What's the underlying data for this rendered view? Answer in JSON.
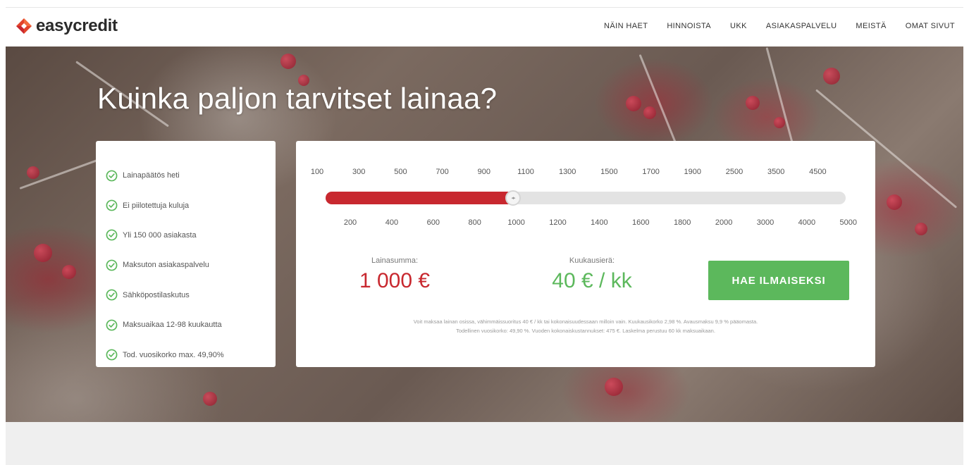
{
  "brand": {
    "name": "easycredit",
    "logo_color": "#e2432a",
    "logo_color_2": "#c8282f"
  },
  "nav": {
    "items": [
      {
        "label": "NÄIN HAET"
      },
      {
        "label": "HINNOISTA"
      },
      {
        "label": "UKK"
      },
      {
        "label": "ASIAKASPALVELU"
      },
      {
        "label": "MEISTÄ"
      },
      {
        "label": "OMAT SIVUT"
      }
    ]
  },
  "hero": {
    "title": "Kuinka paljon tarvitset lainaa?"
  },
  "features": [
    {
      "text": "Lainapäätös heti",
      "icon": "check-circle-icon"
    },
    {
      "text": "Ei piilotettuja kuluja",
      "icon": "check-circle-icon"
    },
    {
      "text": "Yli 150 000 asiakasta",
      "icon": "check-circle-icon"
    },
    {
      "text": "Maksuton asiakaspalvelu",
      "icon": "check-circle-icon"
    },
    {
      "text": "Sähköpostilaskutus",
      "icon": "check-circle-icon"
    },
    {
      "text": "Maksuaikaa 12-98 kuukautta",
      "icon": "check-circle-icon"
    },
    {
      "text": "Tod. vuosikorko max. 49,90%",
      "icon": "check-circle-icon"
    }
  ],
  "calculator": {
    "top_ticks": [
      "100",
      "300",
      "500",
      "700",
      "900",
      "1100",
      "1300",
      "1500",
      "1700",
      "1900",
      "2500",
      "3500",
      "4500"
    ],
    "bottom_ticks": [
      "200",
      "400",
      "600",
      "800",
      "1000",
      "1200",
      "1400",
      "1600",
      "1800",
      "2000",
      "3000",
      "4000",
      "5000"
    ],
    "slider_fraction": 0.36,
    "amount_label": "Lainasumma:",
    "amount_value": "1 000 €",
    "monthly_label": "Kuukausierä:",
    "monthly_value": "40 € / kk",
    "cta_label": "HAE ILMAISEKSI",
    "disclaimer_line1": "Voit maksaa lainan osissa, vähimmäissuoritus 40 € / kk tai kokonaisuudessaan milloin vain. Kuukausikorko 2,98 %. Avausmaksu 9,9 % pääomasta.",
    "disclaimer_line2": "Todellinen vuosikorko: 49,90 %. Vuoden kokonaiskustannukset: 475 €. Laskelma perustuu 60 kk maksuaikaan.",
    "accent_red": "#c8282f",
    "accent_green": "#5cb85c"
  }
}
